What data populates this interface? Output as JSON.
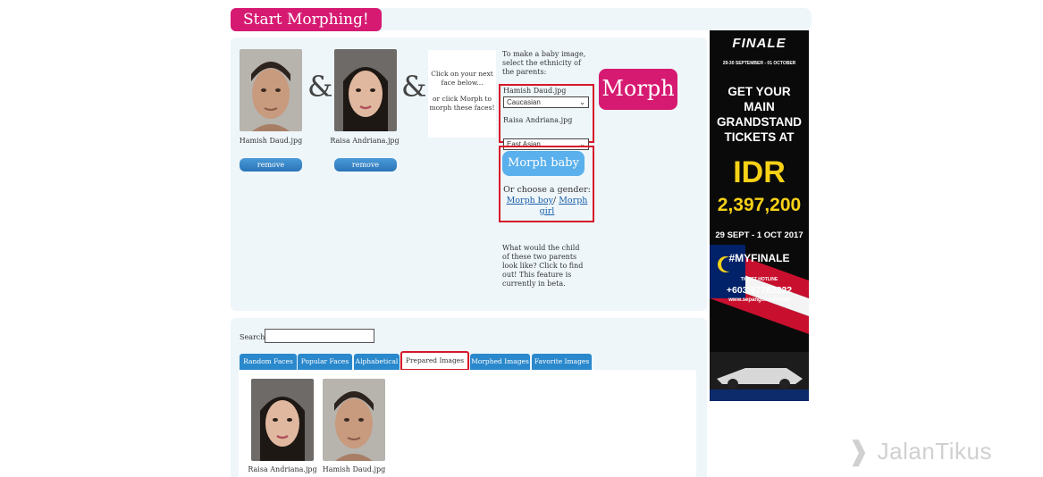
{
  "header": {
    "title": "Start Morphing!"
  },
  "parents": [
    {
      "file_name": "Hamish Daud.jpg",
      "remove_label": "remove"
    },
    {
      "file_name": "Raisa Andriana.jpg",
      "remove_label": "remove"
    }
  ],
  "ampersand": "&",
  "hint": {
    "line1": "Click on your next face below...",
    "line2": "or click Morph to morph these faces!"
  },
  "ethnicity": {
    "intro": "To make a baby image, select the ethnicity of the parents:",
    "parent1_label": "Hamish Daud.jpg",
    "parent1_value": "Caucasian",
    "parent2_label": "Raisa Andriana.jpg",
    "parent2_value": "East Asian"
  },
  "morph_button": "Morph",
  "baby": {
    "button": "Morph baby",
    "gender_prompt": "Or choose a gender:",
    "boy_link": "Morph boy",
    "separator": "/",
    "girl_link": "Morph girl",
    "description": "What would the child of these two parents look like? Click to find out! This feature is currently in beta."
  },
  "search": {
    "label": "Search:",
    "value": ""
  },
  "tabs": [
    {
      "label": "Random Faces",
      "active": false
    },
    {
      "label": "Popular Faces",
      "active": false
    },
    {
      "label": "Alphabetical",
      "active": false
    },
    {
      "label": "Prepared Images",
      "active": true
    },
    {
      "label": "Morphed Images",
      "active": false
    },
    {
      "label": "Favorite Images",
      "active": false
    }
  ],
  "prepared_images": [
    {
      "file_name": "Raisa Andriana.jpg"
    },
    {
      "file_name": "Hamish Daud.jpg"
    }
  ],
  "ad": {
    "brand": "FINALE",
    "dates_top": "29-30 SEPTEMBER - 01 OCTOBER",
    "headline": "GET YOUR MAIN GRANDSTAND TICKETS AT",
    "currency": "IDR",
    "price": "2,397,200",
    "event_dates": "29 SEPT - 1 OCT 2017",
    "hashtag": "#MYFINALE",
    "hotline_label": "TICKET HOTLINE",
    "hotline": "+603 87782222",
    "website": "www.sepangcircuit.com"
  },
  "watermark": "JalanTikus",
  "colors": {
    "brand_pink": "#d61a72",
    "tab_blue": "#2a88cc",
    "highlight_red": "#d6182a",
    "panel_bg": "#eef6fa",
    "baby_blue": "#5ab0ec"
  }
}
